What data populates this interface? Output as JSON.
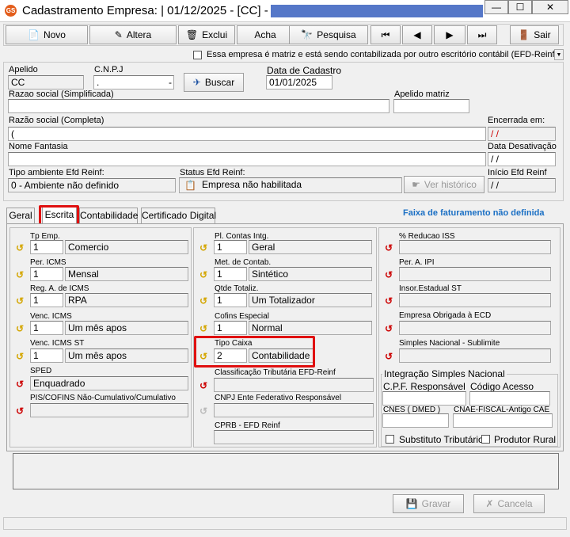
{
  "window": {
    "title": "Cadastramento Empresa: |  01/12/2025 - [CC] -",
    "app_icon": "GS",
    "min": "—",
    "max": "☐",
    "close": "✕"
  },
  "toolbar": {
    "novo": "Novo",
    "altera": "Altera",
    "exclui": "Exclui",
    "acha": "Acha",
    "pesquisa": "Pesquisa",
    "sair": "Sair"
  },
  "matriz_check": "Essa empresa é matriz e está sendo contabilizada por outro escritório contábil (EFD-Reinf",
  "header": {
    "apelido_label": "Apelido",
    "apelido": "CC",
    "cnpj_label": "C.N.P.J",
    "cnpj": ".",
    "cnpj_tail": "-",
    "buscar": "Buscar",
    "data_cadastro_label": "Data de Cadastro",
    "data_cadastro": "01/01/2025",
    "razao_simpl_label": "Razao social (Simplificada)",
    "razao_simpl": "",
    "apelido_matriz_label": "Apelido matriz",
    "apelido_matriz": "",
    "razao_comp_label": "Razão social (Completa)",
    "razao_comp": "(",
    "encerrada_label": "Encerrada em:",
    "encerrada": " / /",
    "nome_fantasia_label": "Nome Fantasia",
    "nome_fantasia": "",
    "data_desativ_label": "Data Desativação",
    "data_desativ": " / /",
    "tipo_amb_label": "Tipo ambiente Efd Reinf:",
    "tipo_amb": "0 - Ambiente não definido",
    "status_label": "Status Efd Reinf:",
    "status": "Empresa não habilitada",
    "ver_historico": "Ver histórico",
    "inicio_label": "Início Efd Reinf",
    "inicio": " / /"
  },
  "tabs": [
    "Geral",
    "Escrita",
    "Contabilidade",
    "Certificado Digital"
  ],
  "faixa": "Faixa de faturamento não definida",
  "col1": [
    {
      "label": "Tp Emp.",
      "code": "1",
      "desc": "Comercio"
    },
    {
      "label": "Per. ICMS",
      "code": "1",
      "desc": "Mensal"
    },
    {
      "label": "Reg. A. de ICMS",
      "code": "1",
      "desc": "RPA"
    },
    {
      "label": "Venc. ICMS",
      "code": "1",
      "desc": "Um mês apos"
    },
    {
      "label": "Venc. ICMS ST",
      "code": "1",
      "desc": "Um mês apos"
    }
  ],
  "sped_label": "SPED",
  "sped": "Enquadrado",
  "pis_label": "PIS/COFINS Não-Cumulativo/Cumulativo",
  "pis": "",
  "col2": [
    {
      "label": "Pl. Contas Intg.",
      "code": "1",
      "desc": "Geral"
    },
    {
      "label": "Met. de Contab.",
      "code": "1",
      "desc": "Sintético"
    },
    {
      "label": "Qtde Totaliz.",
      "code": "1",
      "desc": "Um Totalizador"
    },
    {
      "label": "Cofins Especial",
      "code": "1",
      "desc": "Normal"
    },
    {
      "label": "Tipo Caixa",
      "code": "2",
      "desc": "Contabilidade"
    }
  ],
  "class_trib_label": "Classificação Tributária EFD-Reinf",
  "class_trib": "",
  "cnpj_ente_label": "CNPJ Ente Federativo Responsável",
  "cnpj_ente": "",
  "cprb_label": "CPRB - EFD Reinf",
  "cprb": "",
  "col3": [
    {
      "label": "% Reducao ISS",
      "value": ""
    },
    {
      "label": "Per. A.  IPI",
      "value": ""
    },
    {
      "label": "Insor.Estadual ST",
      "value": ""
    },
    {
      "label": "Empresa Obrigada à ECD",
      "value": ""
    },
    {
      "label": "Simples Nacional - Sublimite",
      "value": ""
    }
  ],
  "simples": {
    "title": "Integração Simples Nacional",
    "cpf_label": "C.P.F. Responsável",
    "cpf": "",
    "codigo_label": "Código Acesso",
    "codigo": "",
    "cnes_label": "CNES ( DMED )",
    "cnes": "",
    "cnae_label": "CNAE-FISCAL-Antigo CAE",
    "cnae": "",
    "subst": "Substituto Tributário",
    "produtor": "Produtor Rural"
  },
  "footer": {
    "gravar": "Gravar",
    "cancelar": "Cancela"
  },
  "colors": {
    "highlight": "#e01010",
    "faixa": "#1a6fc4",
    "redaction": "#5577c8"
  }
}
